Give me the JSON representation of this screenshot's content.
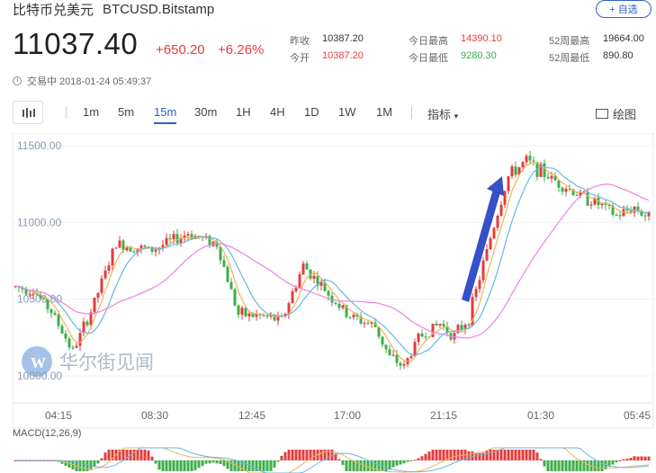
{
  "header": {
    "name": "比特币兑美元",
    "symbol": "BTCUSD.Bitstamp",
    "add_button": "+ 自选"
  },
  "quote": {
    "price": "11037.40",
    "change": "+650.20",
    "change_pct": "+6.26%",
    "prev_close_label": "昨收",
    "prev_close": "10387.20",
    "open_label": "今开",
    "open": "10387.20",
    "day_high_label": "今日最高",
    "day_high": "14390.10",
    "day_low_label": "今日最低",
    "day_low": "9280.30",
    "wk52_high_label": "52周最高",
    "wk52_high": "19664.00",
    "wk52_low_label": "52周最低",
    "wk52_low": "890.80"
  },
  "status": {
    "text": "交易中 2018-01-24 05:49:37"
  },
  "toolbar": {
    "timeframes": [
      "1m",
      "5m",
      "15m",
      "30m",
      "1H",
      "4H",
      "1D",
      "1W",
      "1M"
    ],
    "active_timeframe": "15m",
    "indicator_label": "指标",
    "draw_label": "绘图"
  },
  "watermark": {
    "text": "华尔街见闻"
  },
  "colors": {
    "up": "#e53c3c",
    "down": "#3dae49",
    "ma_fast": "#f0b259",
    "ma_mid": "#66b8e3",
    "ma_slow": "#ee82dd",
    "accent": "#2b63c6",
    "arrow": "#3550c8"
  },
  "chart_data": {
    "type": "candlestick",
    "y_ticks": [
      "11500.00",
      "11000.00",
      "10500.00",
      "10000.00"
    ],
    "x_ticks": [
      "04:15",
      "08:30",
      "12:45",
      "17:00",
      "21:15",
      "01:30",
      "05:45"
    ],
    "ylim": [
      10000,
      11500
    ],
    "indicator": {
      "label": "MACD(12,26,9)"
    },
    "annotations": [
      {
        "type": "arrow"
      }
    ]
  }
}
